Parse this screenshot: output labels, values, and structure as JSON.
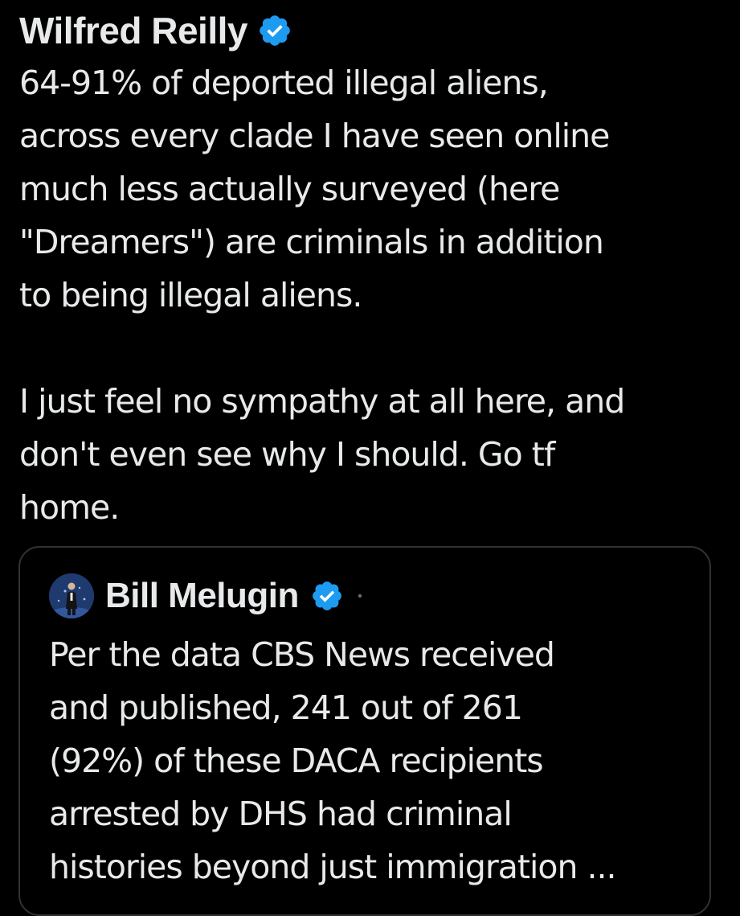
{
  "tweet": {
    "author_name": "Wilfred Reilly",
    "verified_icon": "verified-badge-icon",
    "lines": [
      "64-91% of deported illegal aliens,",
      "across every clade I have seen online",
      "much less actually surveyed (here",
      "\"Dreamers\") are criminals in addition",
      "to being illegal aliens."
    ],
    "lines_2": [
      "I just feel no sympathy at all here, and",
      "don't even see why I should. Go tf",
      "home."
    ]
  },
  "quoted_tweet": {
    "author_name": "Bill Melugin",
    "avatar_icon": "avatar-image",
    "verified_icon": "verified-badge-icon",
    "lines": [
      "Per the data CBS News received",
      "and published, 241 out of 261",
      "(92%) of these DACA recipients",
      "arrested by DHS had criminal",
      "histories beyond just immigration ..."
    ]
  },
  "colors": {
    "background": "#000000",
    "text": "#e7e9ea",
    "verified_blue": "#1d9bf0",
    "card_border": "#2f3336"
  }
}
